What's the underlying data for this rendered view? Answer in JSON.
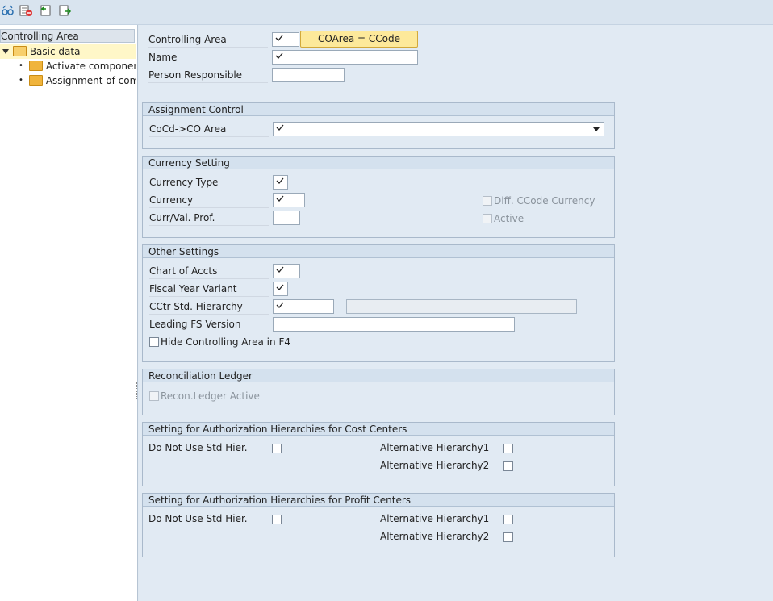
{
  "toolbar": {
    "icons": [
      "glasses-icon",
      "delete-row-icon",
      "undo-icon",
      "export-icon"
    ]
  },
  "tree": {
    "header": "Controlling Area",
    "items": [
      {
        "label": "Basic data"
      },
      {
        "label": "Activate component"
      },
      {
        "label": "Assignment of comp"
      }
    ]
  },
  "top": {
    "controlling_area_label": "Controlling Area",
    "coarea_button": "COArea = CCode",
    "name_label": "Name",
    "person_responsible_label": "Person Responsible"
  },
  "assignment_control": {
    "title": "Assignment Control",
    "cocd_label": "CoCd->CO Area"
  },
  "currency_setting": {
    "title": "Currency Setting",
    "currency_type_label": "Currency Type",
    "currency_label": "Currency",
    "curr_val_prof_label": "Curr/Val. Prof.",
    "diff_ccode_label": "Diff. CCode Currency",
    "active_label": "Active"
  },
  "other_settings": {
    "title": "Other Settings",
    "chart_of_accts_label": "Chart of Accts",
    "fiscal_year_label": "Fiscal Year Variant",
    "cctr_label": "CCtr Std. Hierarchy",
    "leading_fs_label": "Leading FS Version",
    "hide_ca_label": "Hide Controlling Area in F4"
  },
  "reconciliation": {
    "title": "Reconciliation Ledger",
    "recon_active_label": "Recon.Ledger Active"
  },
  "auth_cost": {
    "title": "Setting for Authorization Hierarchies for Cost Centers",
    "do_not_use_label": "Do Not Use Std Hier.",
    "alt1_label": "Alternative Hierarchy1",
    "alt2_label": "Alternative Hierarchy2"
  },
  "auth_profit": {
    "title": "Setting for Authorization Hierarchies for Profit Centers",
    "do_not_use_label": "Do Not Use Std Hier.",
    "alt1_label": "Alternative Hierarchy1",
    "alt2_label": "Alternative Hierarchy2"
  }
}
